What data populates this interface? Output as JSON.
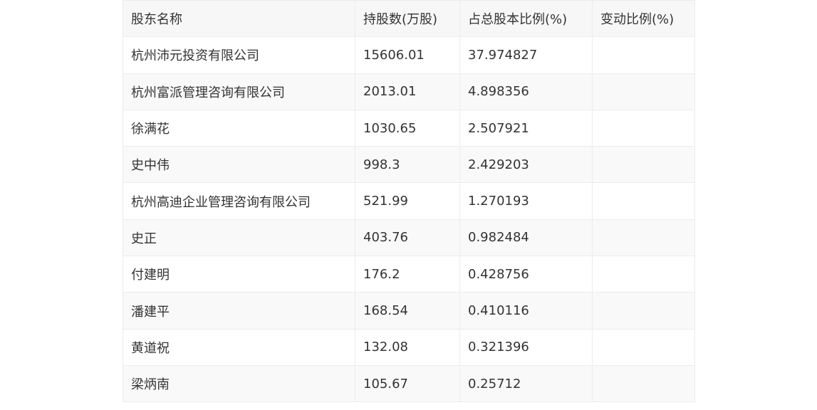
{
  "table": {
    "headers": [
      "股东名称",
      "持股数(万股)",
      "占总股本比例(%)",
      "变动比例(%)"
    ],
    "rows": [
      [
        "杭州沛元投资有限公司",
        "15606.01",
        "37.974827",
        ""
      ],
      [
        "杭州富派管理咨询有限公司",
        "2013.01",
        "4.898356",
        ""
      ],
      [
        "徐满花",
        "1030.65",
        "2.507921",
        ""
      ],
      [
        "史中伟",
        "998.3",
        "2.429203",
        ""
      ],
      [
        "杭州高迪企业管理咨询有限公司",
        "521.99",
        "1.270193",
        ""
      ],
      [
        "史正",
        "403.76",
        "0.982484",
        ""
      ],
      [
        "付建明",
        "176.2",
        "0.428756",
        ""
      ],
      [
        "潘建平",
        "168.54",
        "0.410116",
        ""
      ],
      [
        "黄道祝",
        "132.08",
        "0.321396",
        ""
      ],
      [
        "梁炳南",
        "105.67",
        "0.25712",
        ""
      ]
    ]
  }
}
